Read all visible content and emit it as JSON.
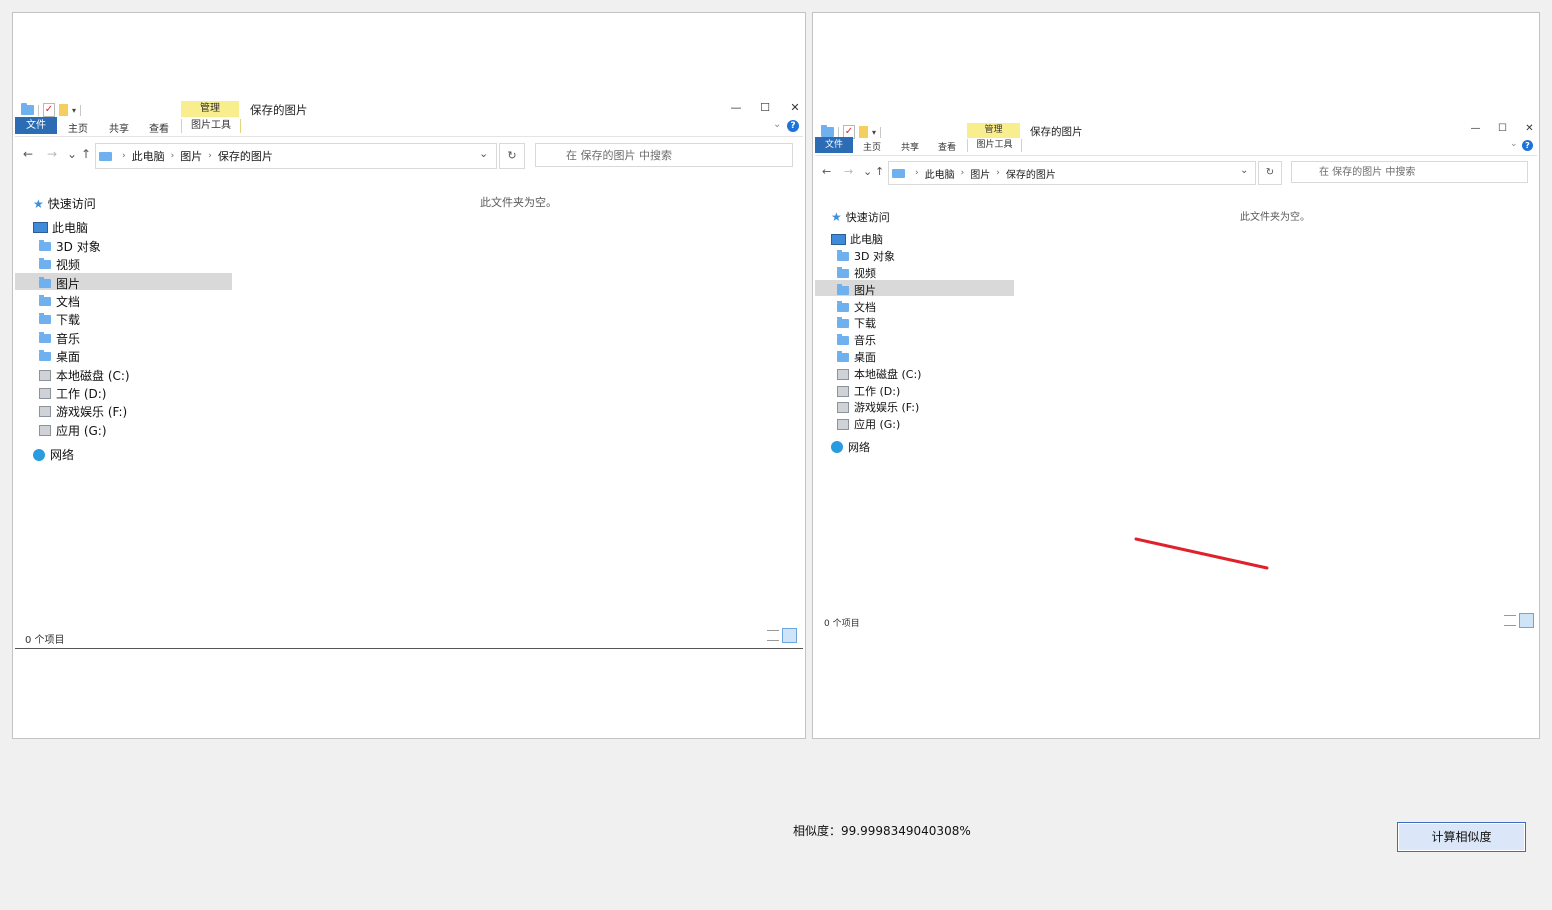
{
  "windows": [
    {
      "ribbon": {
        "context_tab": "管理",
        "context_sub": "图片工具",
        "tabs": [
          "文件",
          "主页",
          "共享",
          "查看"
        ]
      },
      "title": "保存的图片",
      "breadcrumb": [
        "此电脑",
        "图片",
        "保存的图片"
      ],
      "search_placeholder": "在 保存的图片 中搜索",
      "empty_message": "此文件夹为空。",
      "status": "0 个项目",
      "tree": {
        "quick_access": "快速访问",
        "this_pc": "此电脑",
        "items": [
          "3D 对象",
          "视频",
          "图片",
          "文档",
          "下载",
          "音乐",
          "桌面"
        ],
        "drives": [
          "本地磁盘 (C:)",
          "工作 (D:)",
          "游戏娱乐 (F:)",
          "应用 (G:)"
        ],
        "network": "网络",
        "selected": "图片"
      }
    },
    {
      "ribbon": {
        "context_tab": "管理",
        "context_sub": "图片工具",
        "tabs": [
          "文件",
          "主页",
          "共享",
          "查看"
        ]
      },
      "title": "保存的图片",
      "breadcrumb": [
        "此电脑",
        "图片",
        "保存的图片"
      ],
      "search_placeholder": "在 保存的图片 中搜索",
      "empty_message": "此文件夹为空。",
      "status": "0 个项目",
      "tree": {
        "quick_access": "快速访问",
        "this_pc": "此电脑",
        "items": [
          "3D 对象",
          "视频",
          "图片",
          "文档",
          "下载",
          "音乐",
          "桌面"
        ],
        "drives": [
          "本地磁盘 (C:)",
          "工作 (D:)",
          "游戏娱乐 (F:)",
          "应用 (G:)"
        ],
        "network": "网络",
        "selected": "图片"
      }
    }
  ],
  "footer": {
    "similarity": "相似度：99.9998349040308%",
    "compute_button": "计算相似度"
  },
  "colors": {
    "annotation_stroke": "#e0202a",
    "context_tab": "#f9ee8e",
    "file_tab": "#2b6cb5"
  }
}
